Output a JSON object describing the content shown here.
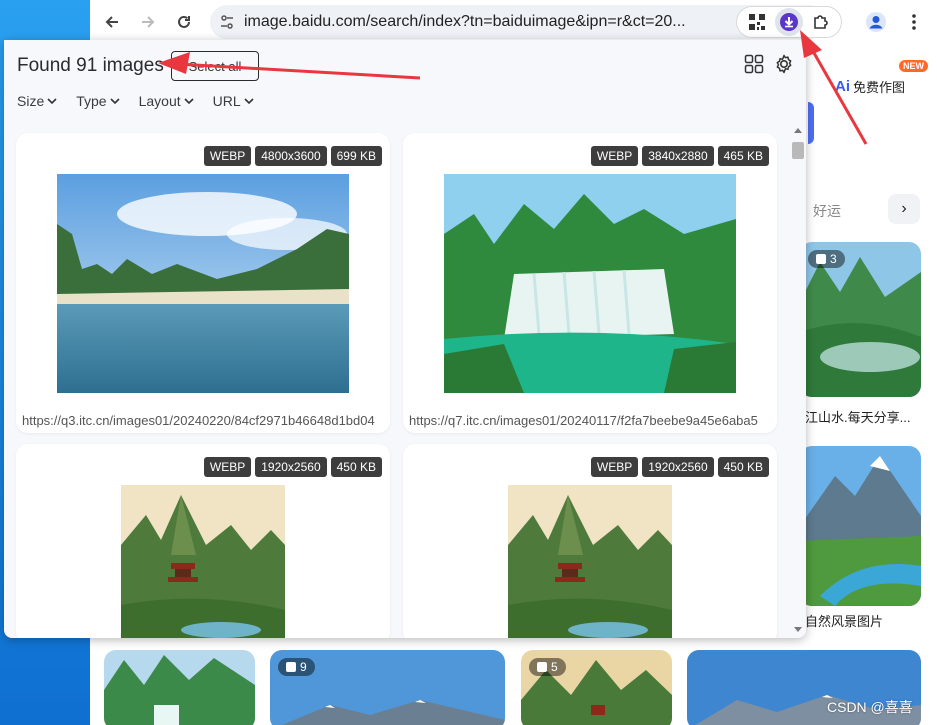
{
  "browser": {
    "url": "image.baidu.com/search/index?tn=baiduimage&ipn=r&ct=20...",
    "colors": {
      "accent": "#4e6ef2",
      "extension_active": "#5a36c8",
      "annotation_red": "#e8373e"
    }
  },
  "background_page": {
    "ai_button": {
      "label_ai": "Ai",
      "label": "免费作图",
      "badge": "NEW"
    },
    "tag": "好运",
    "side_items": [
      {
        "count": "3",
        "caption": "江山水.每天分享..."
      },
      {
        "caption": "自然风景图片"
      }
    ],
    "bottom_counts": [
      "9",
      "5"
    ]
  },
  "popup": {
    "title": "Found 91 images",
    "select_all": "Select all",
    "filters": [
      "Size",
      "Type",
      "Layout",
      "URL"
    ],
    "cards": [
      {
        "format": "WEBP",
        "dimensions": "4800x3600",
        "size": "699 KB",
        "url": "https://q3.itc.cn/images01/20240220/84cf2971b46648d1bd04"
      },
      {
        "format": "WEBP",
        "dimensions": "3840x2880",
        "size": "465 KB",
        "url": "https://q7.itc.cn/images01/20240117/f2fa7beebe9a45e6aba5"
      },
      {
        "format": "WEBP",
        "dimensions": "1920x2560",
        "size": "450 KB",
        "url": ""
      },
      {
        "format": "WEBP",
        "dimensions": "1920x2560",
        "size": "450 KB",
        "url": ""
      }
    ]
  },
  "watermark": "CSDN @喜喜"
}
